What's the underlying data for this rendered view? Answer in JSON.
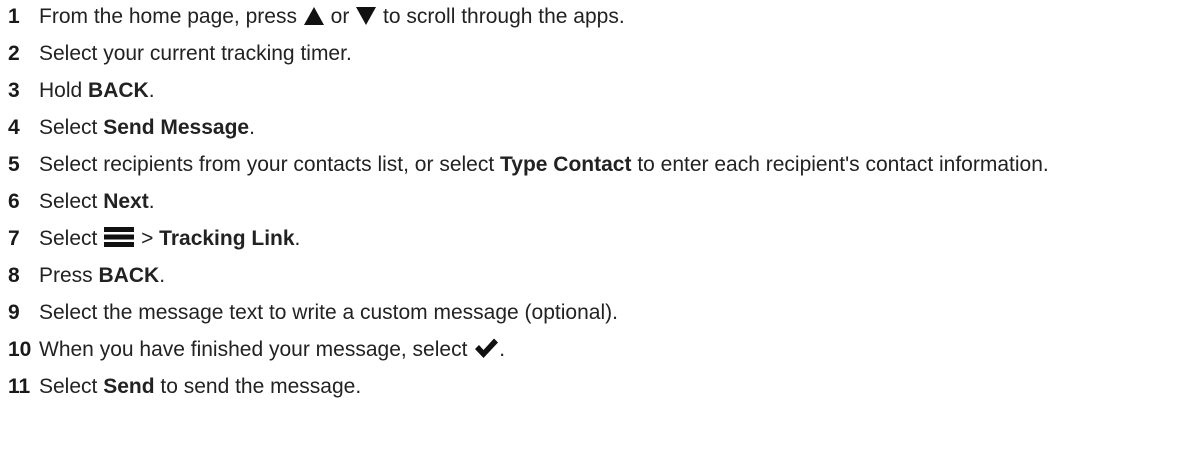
{
  "steps": [
    {
      "number": "1",
      "part1": "From the home page, press",
      "part2": "or",
      "part3": "to scroll through the apps."
    },
    {
      "number": "2",
      "text": "Select your current tracking timer."
    },
    {
      "number": "3",
      "before": "Hold ",
      "bold": "BACK",
      "after": "."
    },
    {
      "number": "4",
      "before": "Select ",
      "bold": "Send Message",
      "after": "."
    },
    {
      "number": "5",
      "before": "Select recipients from your contacts list, or select ",
      "bold": "Type Contact",
      "after": " to enter each recipient's contact information."
    },
    {
      "number": "6",
      "before": "Select ",
      "bold": "Next",
      "after": "."
    },
    {
      "number": "7",
      "before": "Select",
      "separator": ">",
      "bold": "Tracking Link",
      "after": "."
    },
    {
      "number": "8",
      "before": "Press ",
      "bold": "BACK",
      "after": "."
    },
    {
      "number": "9",
      "text": "Select the message text to write a custom message (optional)."
    },
    {
      "number": "10",
      "before": "When you have finished your message, select",
      "after": "."
    },
    {
      "number": "11",
      "before": "Select ",
      "bold": "Send",
      "after": " to send the message."
    }
  ],
  "icons": {
    "up": "up-triangle-icon",
    "down": "down-triangle-icon",
    "menu": "menu-icon",
    "check": "checkmark-icon",
    "color": "#111111"
  }
}
